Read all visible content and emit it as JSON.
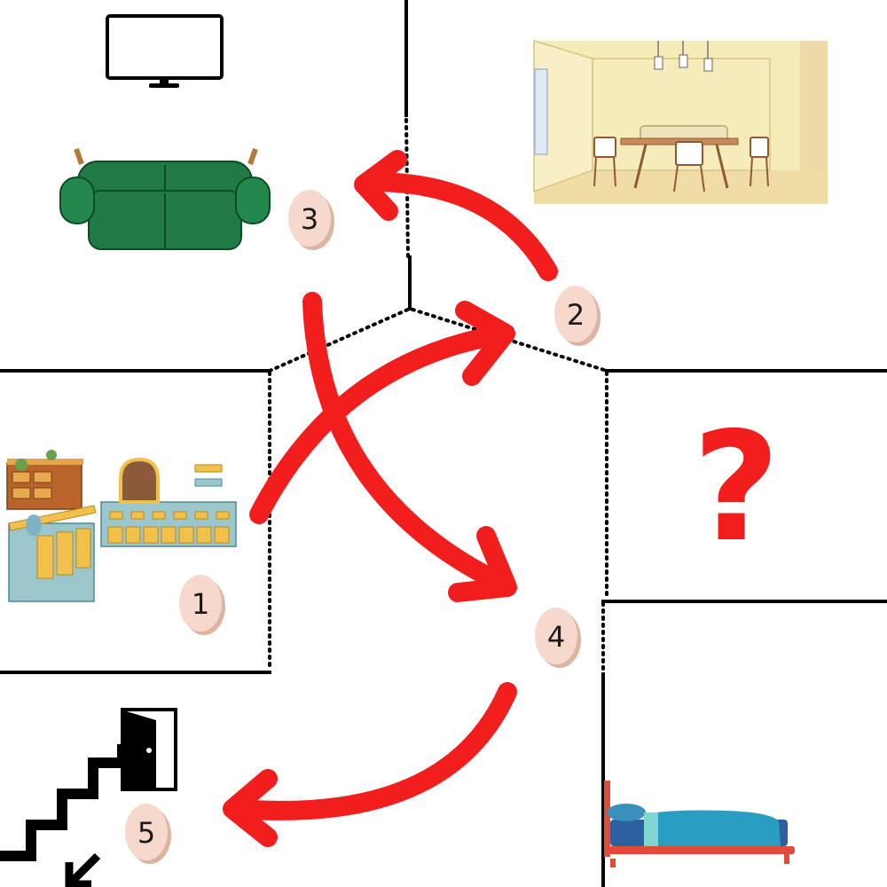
{
  "colors": {
    "arrow": "#f21d1d",
    "wall": "#000000",
    "egg_fill": "#f6d9cc",
    "egg_shadow": "#dcb4a2",
    "question": "#f21d1d",
    "sofa": "#1f7a43",
    "dining_wall": "#f4ebb7",
    "bed_blanket": "#2a9ec2"
  },
  "rooms": {
    "living_room": {
      "icons": [
        "tv-icon",
        "sofa-icon"
      ]
    },
    "dining_room": {
      "icons": [
        "dining-room-icon"
      ]
    },
    "kitchen": {
      "icons": [
        "kitchen-cabinets-icon"
      ]
    },
    "unknown_room": {
      "icons": [
        "question-mark-icon"
      ],
      "symbol": "?"
    },
    "bedroom": {
      "icons": [
        "bed-icon"
      ]
    },
    "exit": {
      "icons": [
        "open-door-icon",
        "stairs-down-icon"
      ]
    }
  },
  "steps": [
    {
      "label": "1",
      "room": "kitchen"
    },
    {
      "label": "2",
      "room": "dining_room"
    },
    {
      "label": "3",
      "room": "living_room"
    },
    {
      "label": "4",
      "room": "hallway"
    },
    {
      "label": "5",
      "room": "exit"
    }
  ],
  "arrows": [
    {
      "from": "1",
      "to": "2"
    },
    {
      "from": "2",
      "to": "3"
    },
    {
      "from": "3",
      "to": "4"
    },
    {
      "from": "4",
      "to": "5"
    }
  ]
}
